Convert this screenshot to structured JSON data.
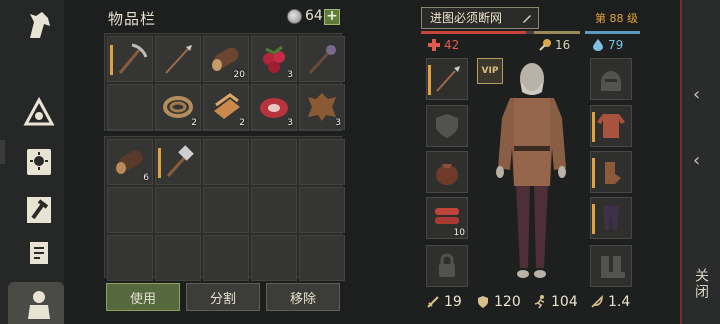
{
  "inventory": {
    "title": "物品栏",
    "coins": "64",
    "plus_label": "+",
    "grid1_counts": [
      "",
      "",
      "20",
      "3",
      "",
      "",
      "2",
      "2",
      "3",
      "3"
    ],
    "grid2_counts": [
      "6"
    ],
    "buttons": {
      "use": "使用",
      "split": "分割",
      "remove": "移除"
    }
  },
  "character": {
    "name": "进图必须断网",
    "level": "第 88 级",
    "health": "42",
    "food": "16",
    "water": "79",
    "vip_label": "VIP",
    "slot_count": "10",
    "stats": {
      "attack": "19",
      "defense": "120",
      "speed": "104",
      "weight": "1.4"
    }
  },
  "right_rail": {
    "close_label": "关闭",
    "arrow_up": "‹",
    "arrow_down": "‹"
  },
  "colors": {
    "accent_orange": "#e0a23a",
    "health": "#e25a4c",
    "water": "#7cc0e3",
    "use_button": "#56683e"
  }
}
